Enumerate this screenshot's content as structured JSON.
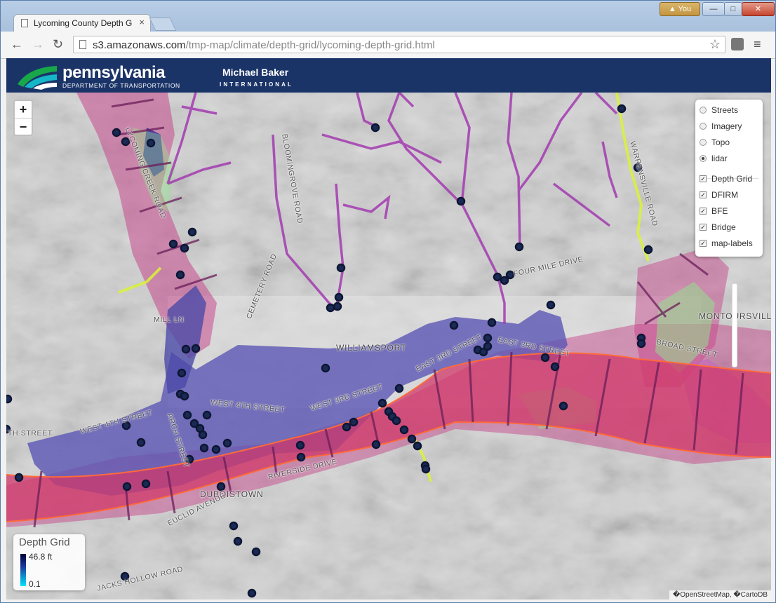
{
  "browser": {
    "tab_title": "Lycoming County Depth G",
    "tab_close": "×",
    "user_label": "You",
    "url_host": "s3.amazonaws.com",
    "url_path": "/tmp-map/climate/depth-grid/lycoming-depth-grid.html",
    "minimize": "—",
    "maximize": "□",
    "close": "✕"
  },
  "header": {
    "logo_title": "pennsylvania",
    "logo_subtitle": "DEPARTMENT OF TRANSPORTATION",
    "partner_name": "Michael Baker",
    "partner_subtitle": "INTERNATIONAL"
  },
  "map": {
    "zoom_in": "+",
    "zoom_out": "−",
    "base_layers": [
      {
        "label": "Streets",
        "selected": false
      },
      {
        "label": "Imagery",
        "selected": false
      },
      {
        "label": "Topo",
        "selected": false
      },
      {
        "label": "lidar",
        "selected": true
      }
    ],
    "overlays": [
      {
        "label": "Depth Grid",
        "checked": true
      },
      {
        "label": "DFIRM",
        "checked": true
      },
      {
        "label": "BFE",
        "checked": true
      },
      {
        "label": "Bridge",
        "checked": true
      },
      {
        "label": "map-labels",
        "checked": true
      }
    ],
    "labels": {
      "lycoming_creek_road": "LYCOMING CREEK ROAD",
      "blooming_grove_road": "BLOOMINGROVE ROAD",
      "cemetery_road": "CEMETERY ROAD",
      "four_mile_drive": "FOUR MILE DRIVE",
      "warrensville_road": "WARRENSVILLE ROAD",
      "mill_ln": "MILL LN",
      "williamsport": "WILLIAMSPORT",
      "east_3rd_street_a": "EAST 3RD STREET",
      "east_3rd_street_b": "EAST 3RD STREET",
      "montoursville": "MONTOURSVILLE",
      "broad_street": "BROAD STREET",
      "west_4th_street_a": "WEST 4TH STREET",
      "west_4th_street_b": "WEST 4TH STREET",
      "west_3rd_street": "WEST 3RD STREET",
      "arch_street": "ARCH STREET",
      "th_street": "TH STREET",
      "riverside_drive": "RIVERSIDE DRIVE",
      "duboistown": "DUBOISTOWN",
      "euclid_avenue": "EUCLID AVENUE",
      "jacks_hollow_road": "JACKS HOLLOW ROAD"
    },
    "legend": {
      "title": "Depth Grid",
      "max": "46.8 ft",
      "min": "0.1"
    },
    "attribution": "�OpenStreetMap, �CartoDB",
    "colors": {
      "depth_shallow": "#00e5ff",
      "depth_deep": "#000033",
      "flood_zone": "#d03a6a",
      "stream": "#a33bb0",
      "road_highlight": "#d9f23a",
      "bridge": "#1a2a55"
    }
  }
}
